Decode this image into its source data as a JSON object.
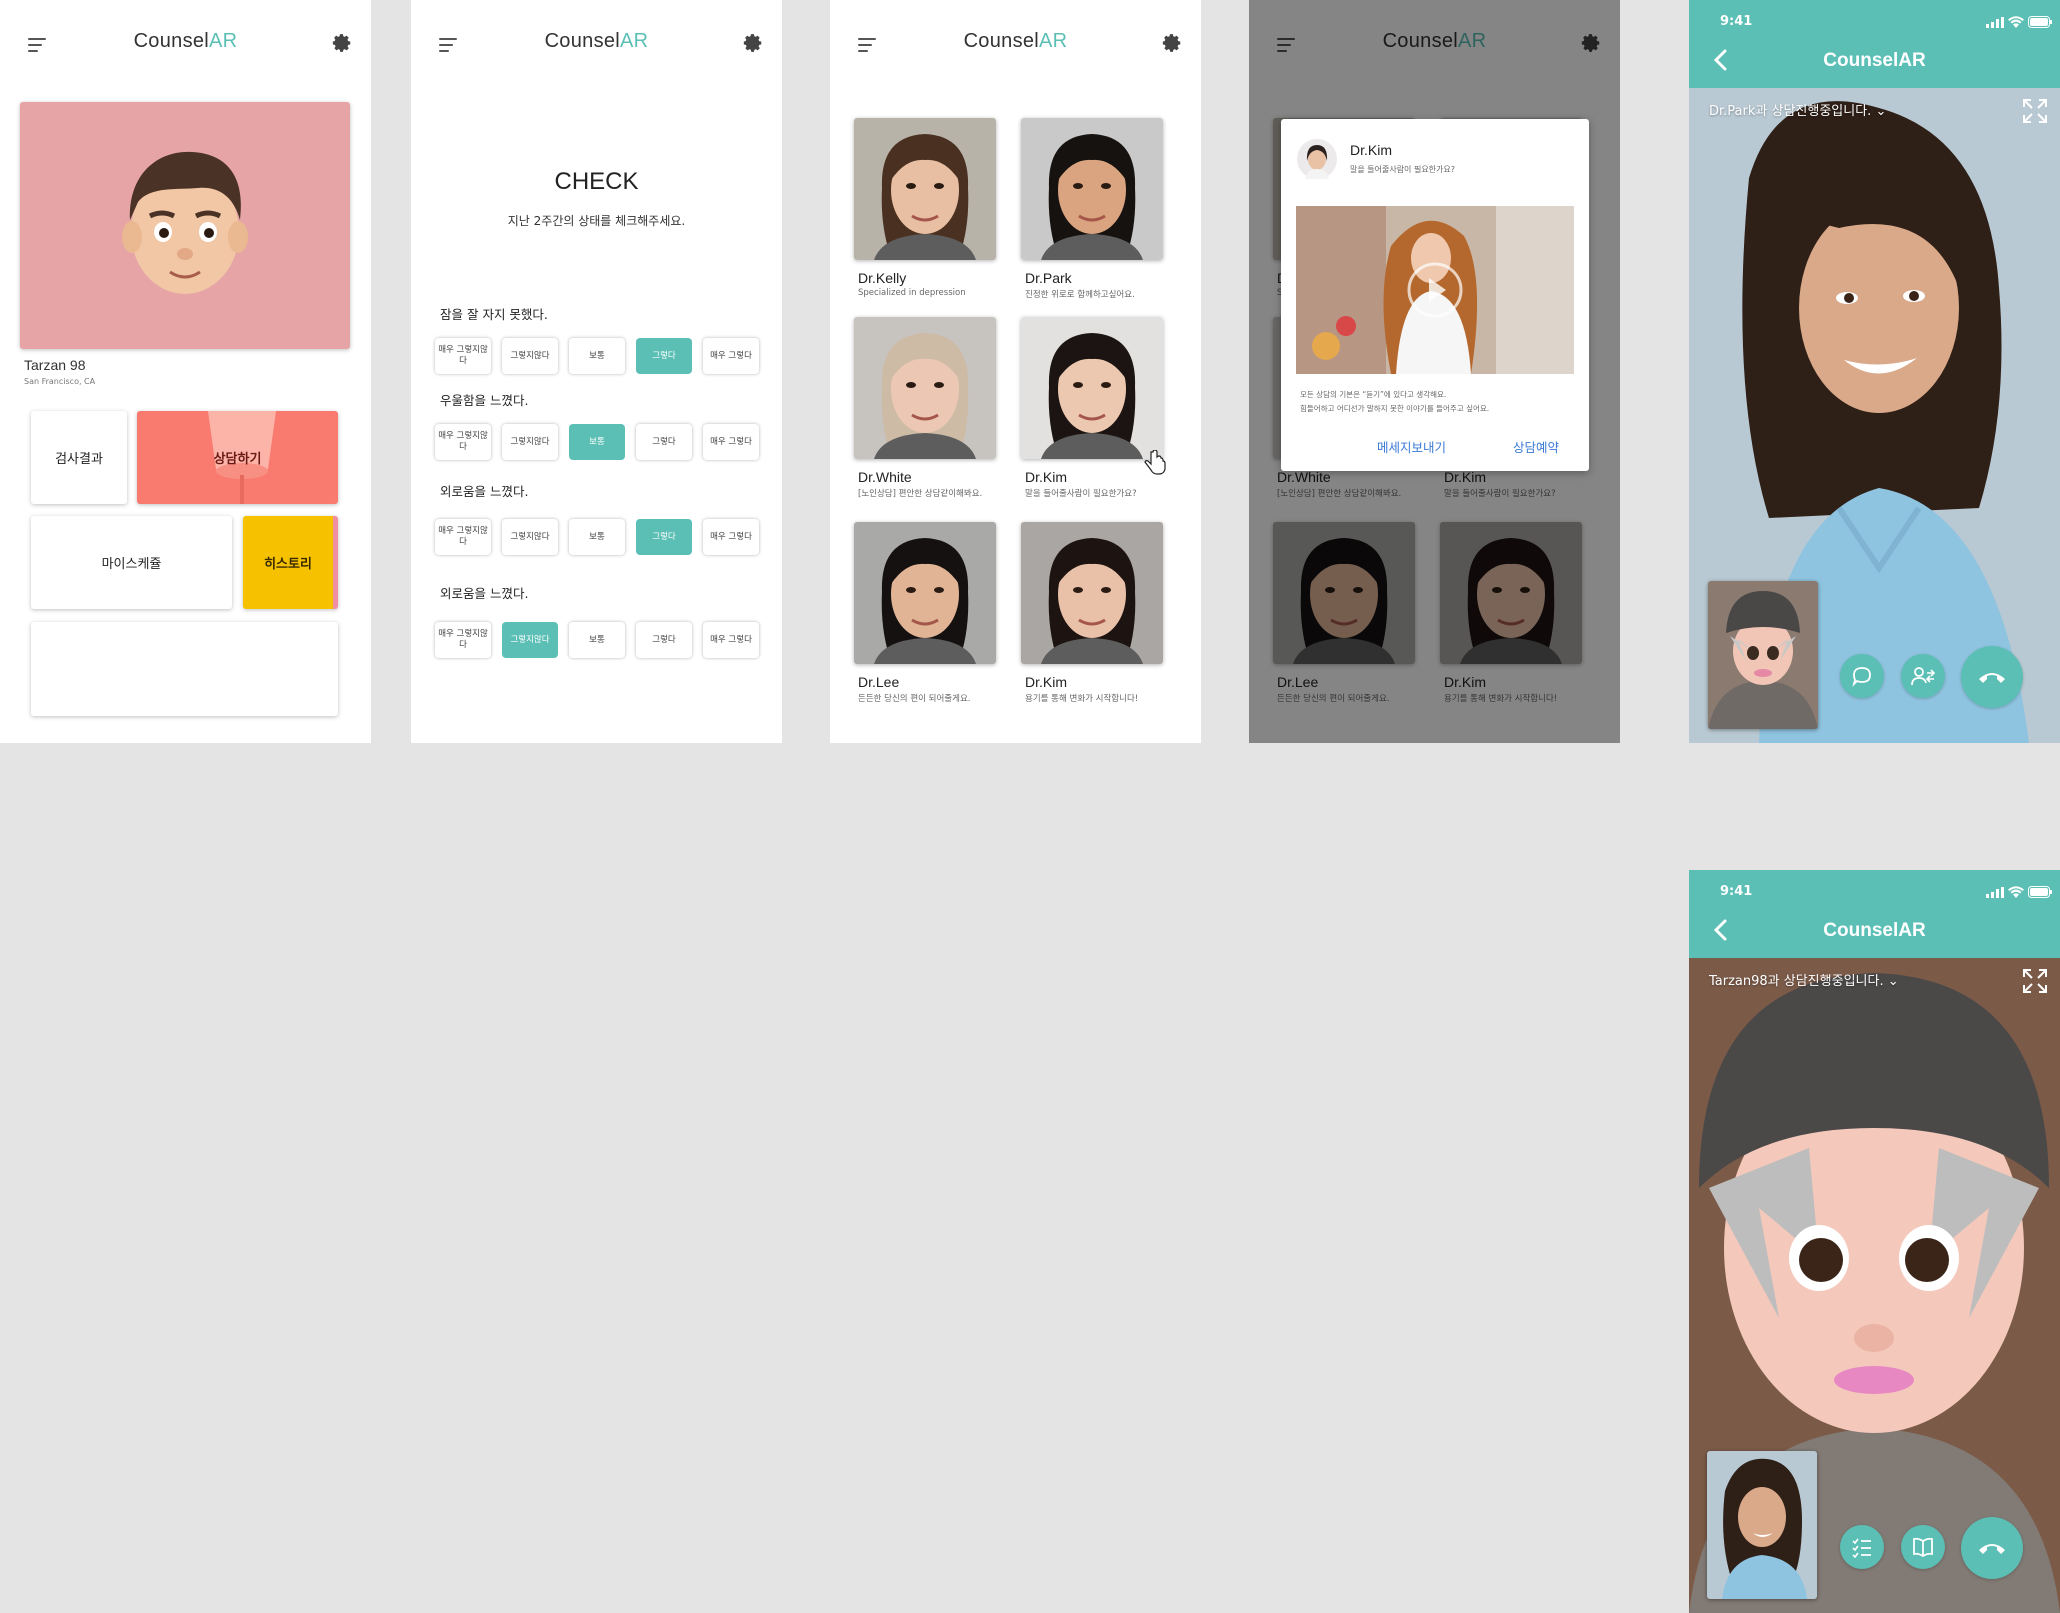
{
  "brand": {
    "name_prefix": "Counsel",
    "name_suffix": "AR",
    "accent": "#5bbfb5"
  },
  "home": {
    "user_name": "Tarzan 98",
    "user_location": "San Francisco, CA",
    "tiles": {
      "results": "검사결과",
      "counsel": "상담하기",
      "schedule": "마이스케쥴",
      "history": "히스토리"
    }
  },
  "check": {
    "title": "CHECK",
    "subtitle": "지난 2주간의 상태를 체크해주세요.",
    "questions": [
      {
        "text": "잠을 잘 자지 못했다.",
        "selected": "3"
      },
      {
        "text": "우울함을 느꼈다.",
        "selected": "2"
      },
      {
        "text": "외로움을 느꼈다.",
        "selected": "3"
      },
      {
        "text": "외로움을 느꼈다.",
        "selected": "1"
      }
    ],
    "options": [
      "매우 그렇지않다",
      "그렇지않다",
      "보통",
      "그렇다",
      "매우 그렇다"
    ]
  },
  "doctors": [
    {
      "name": "Dr.Kelly",
      "desc": "Specialized in depression"
    },
    {
      "name": "Dr.Park",
      "desc": "진정한 위로로 함께하고싶어요."
    },
    {
      "name": "Dr.White",
      "desc": "[노인상담] 편안한 상담같이해봐요."
    },
    {
      "name": "Dr.Kim",
      "desc": "말을 들어줄사람이 필요한가요?"
    },
    {
      "name": "Dr.Lee",
      "desc": "든든한 당신의 편이 되어줄게요."
    },
    {
      "name": "Dr.Kim",
      "desc": "용기를 통해 변화가 시작합니다!"
    }
  ],
  "modal": {
    "name": "Dr.Kim",
    "tagline": "말을 들어줄사람이 필요한가요?",
    "body_line1": "모든 상담의 기본은 “듣기”에 있다고 생각해요.",
    "body_line2": "힘들어하고 어디선가 말하지 못한 이야기를 들어주고 싶어요.",
    "message_btn": "메세지보내기",
    "reserve_btn": "상담예약"
  },
  "call1": {
    "time": "9:41",
    "title": "CounselAR",
    "label": "Dr.Park과 상담진행중입니다."
  },
  "call2": {
    "time": "9:41",
    "title": "CounselAR",
    "label": "Tarzan98과 상담진행중입니다."
  }
}
